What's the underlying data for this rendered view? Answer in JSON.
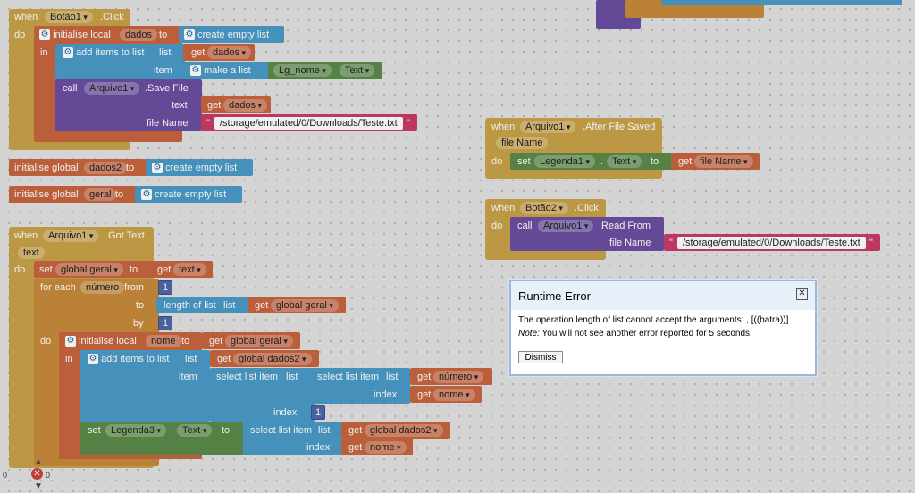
{
  "kw": {
    "when": "when",
    "do": "do",
    "in": "in",
    "call": "call",
    "set": "set",
    "to": "to",
    "get": "get",
    "list": "list",
    "item": "item",
    "text": "text",
    "file_name": "file Name",
    "for_each": "for each",
    "from": "from",
    "by": "by",
    "index": "index",
    "of": "."
  },
  "evt_botao1": {
    "component": "Botão1",
    "event": ".Click"
  },
  "local_dados": {
    "label": "initialise local",
    "name": "dados",
    "value": "create empty list"
  },
  "add_items": {
    "label": "add items to list",
    "list_label": "list",
    "item_label": "item",
    "make_list": "make a list",
    "comp": "Lg_nome",
    "prop": "Text"
  },
  "save_file": {
    "component": "Arquivo1",
    "method": ".Save File",
    "path": "/storage/emulated/0/Downloads/Teste.txt"
  },
  "globals": [
    {
      "label": "initialise global",
      "name": "dados2",
      "value": "create empty list"
    },
    {
      "label": "initialise global",
      "name": "geral",
      "value": "create empty list"
    }
  ],
  "evt_gottext": {
    "component": "Arquivo1",
    "event": ".Got Text",
    "param": "text"
  },
  "set_global_geral": "global geral",
  "for_each": {
    "var": "número",
    "from": "1",
    "by": "1",
    "length_label": "length of list",
    "list_label": "list"
  },
  "local_nome": {
    "label": "initialise local",
    "name": "nome",
    "value": "global geral"
  },
  "add_items2": {
    "list": "global dados2",
    "select": "select list item",
    "idx1": "número",
    "idx2": "nome",
    "idx3": "1"
  },
  "set_legenda3": {
    "comp": "Legenda3",
    "prop": "Text",
    "select": "select list item",
    "list": "global dados2",
    "index": "nome"
  },
  "evt_aftersaved": {
    "component": "Arquivo1",
    "event": ".After File Saved",
    "param": "file Name",
    "set_comp": "Legenda1",
    "set_prop": "Text",
    "get_val": "file Name"
  },
  "evt_botao2": {
    "component": "Botão2",
    "event": ".Click",
    "call_comp": "Arquivo1",
    "method": ".Read From",
    "path": "/storage/emulated/0/Downloads/Teste.txt"
  },
  "dialog": {
    "title": "Runtime Error",
    "message": "The operation length of list cannot accept the arguments: , [((batra))]",
    "note_label": "Note:",
    "note": "You will not see another error reported for 5 seconds.",
    "dismiss": "Dismiss"
  },
  "warnings": {
    "warn_count": "0",
    "error_count": "0"
  },
  "colors": {
    "event": "#c8a24a",
    "control": "#c78a3a",
    "variable": "#c7653f",
    "list": "#4a9bc8",
    "procedure": "#6b4fa0",
    "text": "#c93c67",
    "component": "#5b8a4a"
  }
}
